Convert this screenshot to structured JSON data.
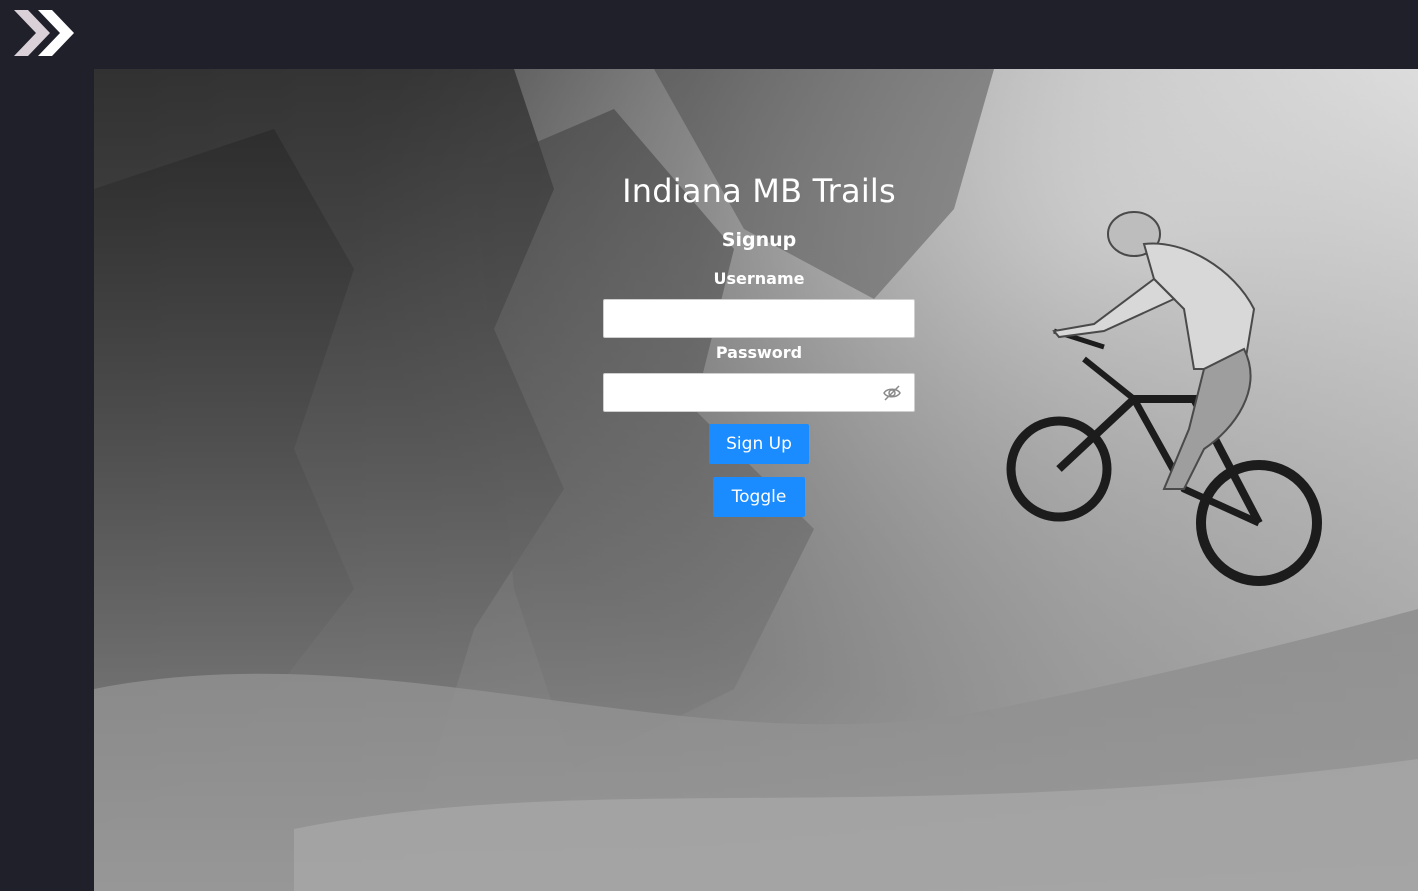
{
  "app": {
    "title": "Indiana MB Trails"
  },
  "nav": {
    "expand_icon": "double-chevron-right-icon"
  },
  "form": {
    "heading": "Signup",
    "username_label": "Username",
    "username_value": "",
    "password_label": "Password",
    "password_value": "",
    "password_visibility_icon": "eye-off-icon",
    "submit_label": "Sign Up",
    "toggle_label": "Toggle"
  },
  "colors": {
    "background": "#20202b",
    "button": "#1a8cff",
    "text": "#ffffff"
  }
}
